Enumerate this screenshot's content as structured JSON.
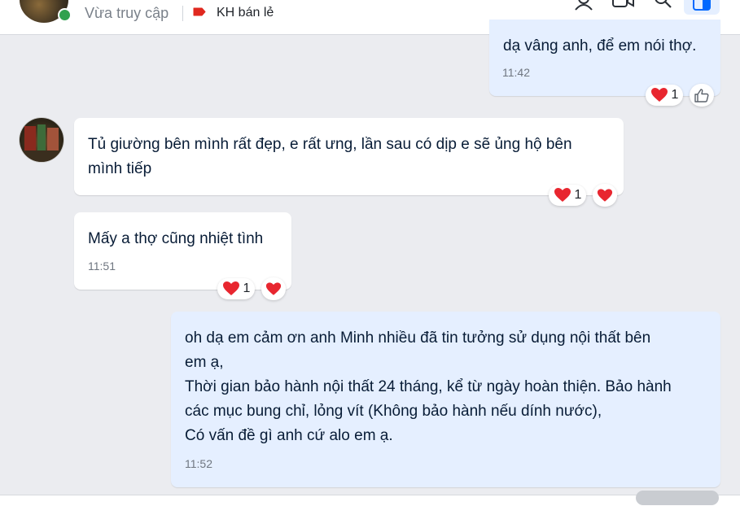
{
  "header": {
    "status": "Vừa truy cập",
    "tag_label": "KH bán lẻ",
    "tag_color": "#e0281f",
    "icons": [
      "contact-icon",
      "video-call-icon",
      "search-icon",
      "sidebar-toggle-icon"
    ]
  },
  "messages": [
    {
      "from": "me",
      "text": "dạ vâng anh, để em nói thợ.",
      "time": "11:42",
      "reaction": "heart",
      "reaction_count": "1"
    },
    {
      "from": "contact",
      "text": "Tủ giường bên mình rất đẹp, e rất ưng, lần sau có dịp e sẽ ủng hộ bên\nmình tiếp",
      "reaction": "heart",
      "reaction_count": "1"
    },
    {
      "from": "contact",
      "text": "Mấy a thợ cũng nhiệt tình",
      "time": "11:51",
      "reaction": "heart",
      "reaction_count": "1"
    },
    {
      "from": "me",
      "text": "oh dạ em cảm ơn anh Minh nhiều đã tin tưởng sử dụng nội thất bên\nem ạ,\nThời gian bảo hành nội thất 24 tháng, kể từ ngày hoàn thiện. Bảo hành\ncác mục bung chỉ, lỏng vít (Không bảo hành nếu dính nước),\nCó vấn đề gì anh cứ alo em ạ.",
      "time": "11:52"
    }
  ],
  "colors": {
    "chat_bg": "#ebecf0",
    "my_bubble": "#e5efff",
    "their_bubble": "#ffffff",
    "heart": "#e8262f",
    "online": "#30a14e"
  }
}
